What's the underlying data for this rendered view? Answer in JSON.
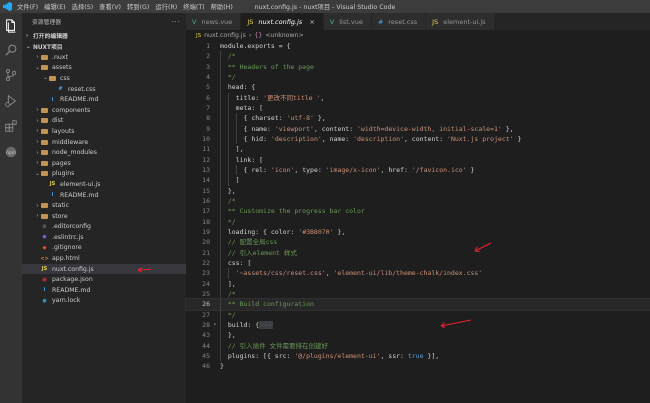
{
  "titlebar": {
    "menu": [
      "文件(F)",
      "编辑(E)",
      "选择(S)",
      "查看(V)",
      "转到(G)",
      "运行(R)",
      "终端(T)",
      "帮助(H)"
    ],
    "window_title": "nuxt.config.js - nuxt项目 - Visual Studio Code"
  },
  "activity_icons": [
    "files-icon",
    "search-icon",
    "source-control-icon",
    "run-debug-icon",
    "extensions-icon",
    "npm-icon"
  ],
  "sidebar": {
    "title": "资源管理器",
    "more": "···",
    "open_editors": "打开的编辑器",
    "project": "NUXT项目",
    "tree": [
      {
        "label": ".nuxt",
        "depth": 1,
        "arrow": "›",
        "icon": "folder"
      },
      {
        "label": "assets",
        "depth": 1,
        "arrow": "⌄",
        "icon": "folder"
      },
      {
        "label": "css",
        "depth": 2,
        "arrow": "⌄",
        "icon": "folder"
      },
      {
        "label": "reset.css",
        "depth": 3,
        "arrow": "",
        "icon": "css"
      },
      {
        "label": "README.md",
        "depth": 2,
        "arrow": "",
        "icon": "info"
      },
      {
        "label": "components",
        "depth": 1,
        "arrow": "›",
        "icon": "folder"
      },
      {
        "label": "dist",
        "depth": 1,
        "arrow": "›",
        "icon": "folder"
      },
      {
        "label": "layouts",
        "depth": 1,
        "arrow": "›",
        "icon": "folder"
      },
      {
        "label": "middleware",
        "depth": 1,
        "arrow": "›",
        "icon": "folder"
      },
      {
        "label": "node_modules",
        "depth": 1,
        "arrow": "›",
        "icon": "folder"
      },
      {
        "label": "pages",
        "depth": 1,
        "arrow": "›",
        "icon": "folder"
      },
      {
        "label": "plugins",
        "depth": 1,
        "arrow": "⌄",
        "icon": "folder"
      },
      {
        "label": "element-ui.js",
        "depth": 2,
        "arrow": "",
        "icon": "js"
      },
      {
        "label": "README.md",
        "depth": 2,
        "arrow": "",
        "icon": "info"
      },
      {
        "label": "static",
        "depth": 1,
        "arrow": "›",
        "icon": "folder"
      },
      {
        "label": "store",
        "depth": 1,
        "arrow": "›",
        "icon": "folder"
      },
      {
        "label": ".editorconfig",
        "depth": 1,
        "arrow": "",
        "icon": "gear"
      },
      {
        "label": ".eslintrc.js",
        "depth": 1,
        "arrow": "",
        "icon": "eslint"
      },
      {
        "label": ".gitignore",
        "depth": 1,
        "arrow": "",
        "icon": "git"
      },
      {
        "label": "app.html",
        "depth": 1,
        "arrow": "",
        "icon": "html"
      },
      {
        "label": "nuxt.config.js",
        "depth": 1,
        "arrow": "",
        "icon": "js",
        "selected": true
      },
      {
        "label": "package.json",
        "depth": 1,
        "arrow": "",
        "icon": "npm"
      },
      {
        "label": "README.md",
        "depth": 1,
        "arrow": "",
        "icon": "info"
      },
      {
        "label": "yarn.lock",
        "depth": 1,
        "arrow": "",
        "icon": "yarn"
      }
    ]
  },
  "tabs": [
    {
      "label": "news.vue",
      "icon": "vue",
      "active": false
    },
    {
      "label": "nuxt.config.js",
      "icon": "js",
      "active": true,
      "close": "×"
    },
    {
      "label": "list.vue",
      "icon": "vue",
      "active": false
    },
    {
      "label": "reset.css",
      "icon": "css",
      "active": false
    },
    {
      "label": "element-ui.js",
      "icon": "js",
      "active": false
    }
  ],
  "breadcrumb": {
    "file": "nuxt.config.js",
    "symbol": "<unknown>"
  },
  "code_lines": [
    {
      "n": "1",
      "indent": 0,
      "t": [
        [
          "module.exports = {",
          "#d4d4d4"
        ]
      ]
    },
    {
      "n": "2",
      "indent": 1,
      "t": [
        [
          "/*",
          "#6a9955"
        ]
      ]
    },
    {
      "n": "3",
      "indent": 1,
      "t": [
        [
          "** Headers of the page",
          "#6a9955"
        ]
      ]
    },
    {
      "n": "4",
      "indent": 1,
      "t": [
        [
          "*/",
          "#6a9955"
        ]
      ]
    },
    {
      "n": "5",
      "indent": 1,
      "t": [
        [
          "head: {",
          "#d4d4d4"
        ]
      ]
    },
    {
      "n": "6",
      "indent": 2,
      "t": [
        [
          "title: ",
          "#d4d4d4"
        ],
        [
          "'更改不同title '",
          "#ce9178"
        ],
        [
          ",",
          "#d4d4d4"
        ]
      ]
    },
    {
      "n": "7",
      "indent": 2,
      "t": [
        [
          "meta: [",
          "#d4d4d4"
        ]
      ]
    },
    {
      "n": "8",
      "indent": 3,
      "t": [
        [
          "{ charset: ",
          "#d4d4d4"
        ],
        [
          "'utf-8'",
          "#ce9178"
        ],
        [
          " },",
          "#d4d4d4"
        ]
      ]
    },
    {
      "n": "9",
      "indent": 3,
      "t": [
        [
          "{ name: ",
          "#d4d4d4"
        ],
        [
          "'viewport'",
          "#ce9178"
        ],
        [
          ", content: ",
          "#d4d4d4"
        ],
        [
          "'width=device-width, initial-scale=1'",
          "#ce9178"
        ],
        [
          " },",
          "#d4d4d4"
        ]
      ]
    },
    {
      "n": "10",
      "indent": 3,
      "t": [
        [
          "{ hid: ",
          "#d4d4d4"
        ],
        [
          "'description'",
          "#ce9178"
        ],
        [
          ", name: ",
          "#d4d4d4"
        ],
        [
          "'description'",
          "#ce9178"
        ],
        [
          ", content: ",
          "#d4d4d4"
        ],
        [
          "'Nuxt.js project'",
          "#ce9178"
        ],
        [
          " }",
          "#d4d4d4"
        ]
      ]
    },
    {
      "n": "11",
      "indent": 2,
      "t": [
        [
          "],",
          "#d4d4d4"
        ]
      ]
    },
    {
      "n": "12",
      "indent": 2,
      "t": [
        [
          "link: [",
          "#d4d4d4"
        ]
      ]
    },
    {
      "n": "13",
      "indent": 3,
      "t": [
        [
          "{ rel: ",
          "#d4d4d4"
        ],
        [
          "'icon'",
          "#ce9178"
        ],
        [
          ", type: ",
          "#d4d4d4"
        ],
        [
          "'image/x-icon'",
          "#ce9178"
        ],
        [
          ", href: ",
          "#d4d4d4"
        ],
        [
          "'/favicon.ico'",
          "#ce9178"
        ],
        [
          " }",
          "#d4d4d4"
        ]
      ]
    },
    {
      "n": "14",
      "indent": 2,
      "t": [
        [
          "]",
          "#d4d4d4"
        ]
      ]
    },
    {
      "n": "15",
      "indent": 1,
      "t": [
        [
          "},",
          "#d4d4d4"
        ]
      ]
    },
    {
      "n": "16",
      "indent": 1,
      "t": [
        [
          "/*",
          "#6a9955"
        ]
      ]
    },
    {
      "n": "17",
      "indent": 1,
      "t": [
        [
          "** Customize the progress bar color",
          "#6a9955"
        ]
      ]
    },
    {
      "n": "18",
      "indent": 1,
      "t": [
        [
          "*/",
          "#6a9955"
        ]
      ]
    },
    {
      "n": "19",
      "indent": 1,
      "t": [
        [
          "loading: { color: ",
          "#d4d4d4"
        ],
        [
          "'#3B8070'",
          "#ce9178"
        ],
        [
          " },",
          "#d4d4d4"
        ]
      ]
    },
    {
      "n": "20",
      "indent": 1,
      "t": [
        [
          "// 配置全局css",
          "#6a9955"
        ]
      ]
    },
    {
      "n": "21",
      "indent": 1,
      "t": [
        [
          "// 引入element 样式",
          "#6a9955"
        ]
      ]
    },
    {
      "n": "22",
      "indent": 1,
      "t": [
        [
          "css: [",
          "#d4d4d4"
        ]
      ]
    },
    {
      "n": "23",
      "indent": 2,
      "t": [
        [
          "'~assets/css/reset.css'",
          "#ce9178"
        ],
        [
          ", ",
          "#d4d4d4"
        ],
        [
          "'element-ui/lib/theme-chalk/index.css'",
          "#ce9178"
        ]
      ]
    },
    {
      "n": "24",
      "indent": 1,
      "t": [
        [
          "],",
          "#d4d4d4"
        ]
      ]
    },
    {
      "n": "25",
      "indent": 1,
      "t": [
        [
          "/*",
          "#6a9955"
        ]
      ]
    },
    {
      "n": "26",
      "indent": 1,
      "t": [
        [
          "** Build configuration",
          "#6a9955"
        ]
      ],
      "current": true
    },
    {
      "n": "27",
      "indent": 1,
      "t": [
        [
          "*/",
          "#6a9955"
        ]
      ]
    },
    {
      "n": "28",
      "indent": 1,
      "t": [
        [
          "build: {",
          "#d4d4d4"
        ],
        [
          "···",
          "#808080"
        ]
      ],
      "fold": "›"
    },
    {
      "n": "43",
      "indent": 1,
      "t": [
        [
          "},",
          "#d4d4d4"
        ]
      ]
    },
    {
      "n": "44",
      "indent": 1,
      "t": [
        [
          "// 引入插件 文件需要排在创建好",
          "#6a9955"
        ]
      ]
    },
    {
      "n": "45",
      "indent": 1,
      "t": [
        [
          "plugins: [{ src: ",
          "#d4d4d4"
        ],
        [
          "'@/plugins/element-ui'",
          "#ce9178"
        ],
        [
          ", ssr: ",
          "#d4d4d4"
        ],
        [
          "true",
          "#569cd6"
        ],
        [
          " }],",
          "#d4d4d4"
        ]
      ]
    },
    {
      "n": "46",
      "indent": 0,
      "t": [
        [
          "}",
          "#d4d4d4"
        ]
      ]
    }
  ],
  "colors": {
    "annotation_arrow": "#e8232b",
    "selection": "#37373d",
    "accent": "#007acc"
  }
}
